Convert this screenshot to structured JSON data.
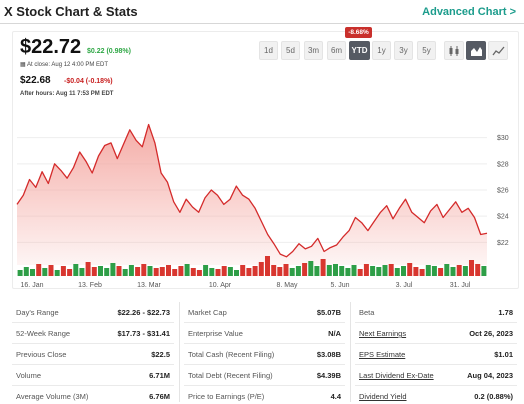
{
  "header": {
    "title": "X Stock Chart & Stats",
    "advanced_link": "Advanced Chart >"
  },
  "quote": {
    "price": "$22.72",
    "change": "$0.22 (0.98%)",
    "close_note": "At close: Aug 12 4:00 PM EDT",
    "after_hours_price": "$22.68",
    "after_hours_change": "-$0.04 (-0.18%)",
    "after_hours_note": "After hours: Aug 11 7:53 PM EDT"
  },
  "ranges": {
    "buttons": [
      "1d",
      "5d",
      "3m",
      "6m",
      "YTD",
      "1y",
      "3y",
      "5y"
    ],
    "active": "YTD",
    "active_change": "-8.68%"
  },
  "chart_types": [
    {
      "name": "candlestick-icon",
      "active": false
    },
    {
      "name": "mountain-icon",
      "active": true
    },
    {
      "name": "line-chart-icon",
      "active": false
    }
  ],
  "colors": {
    "line": "#d42b2b",
    "fill": "#f4a8a2",
    "volume_red": "#d8362f",
    "volume_green": "#2e9e47",
    "link": "#1c9c8c",
    "positive": "#2ea745",
    "negative": "#c81e1e"
  },
  "chart_data": {
    "type": "area",
    "x_ticks": [
      "16. Jan",
      "13. Feb",
      "13. Mar",
      "10. Apr",
      "8. May",
      "5. Jun",
      "3. Jul",
      "31. Jul"
    ],
    "y_ticks": [
      22,
      24,
      26,
      28,
      30
    ],
    "ylim": [
      20.5,
      31.5
    ],
    "grid": true,
    "series": [
      {
        "values": [
          24.9,
          25.6,
          26.8,
          26.2,
          27.4,
          26.5,
          28.0,
          27.5,
          26.9,
          27.7,
          28.9,
          28.2,
          27.3,
          28.6,
          29.4,
          29.6,
          28.4,
          29.5,
          30.6,
          29.8,
          29.3,
          31.0,
          29.6,
          27.3,
          26.6,
          25.1,
          24.3,
          25.3,
          24.7,
          24.3,
          25.4,
          26.0,
          25.6,
          24.9,
          25.3,
          26.3,
          25.6,
          25.3,
          24.6,
          23.6,
          22.6,
          21.9,
          21.1,
          20.9,
          21.3,
          21.9,
          21.5,
          21.7,
          22.3,
          21.3,
          21.6,
          21.8,
          22.4,
          22.9,
          23.9,
          23.5,
          22.9,
          23.6,
          24.3,
          24.8,
          23.8,
          24.6,
          25.3,
          24.3,
          23.9,
          23.5,
          24.4,
          24.9,
          23.9,
          24.5,
          25.1,
          24.3,
          24.6,
          23.9,
          22.6,
          22.7
        ]
      }
    ],
    "volume_relative": [
      0.3,
      0.45,
      0.35,
      0.6,
      0.4,
      0.55,
      0.3,
      0.5,
      0.35,
      0.6,
      0.4,
      0.7,
      0.45,
      0.5,
      0.4,
      0.65,
      0.5,
      0.35,
      0.55,
      0.45,
      0.6,
      0.5,
      0.4,
      0.45,
      0.55,
      0.35,
      0.5,
      0.6,
      0.4,
      0.3,
      0.55,
      0.4,
      0.35,
      0.5,
      0.45,
      0.3,
      0.55,
      0.4,
      0.5,
      0.7,
      1.0,
      0.55,
      0.45,
      0.6,
      0.4,
      0.5,
      0.65,
      0.75,
      0.5,
      0.85,
      0.55,
      0.6,
      0.5,
      0.4,
      0.55,
      0.35,
      0.6,
      0.5,
      0.45,
      0.55,
      0.6,
      0.4,
      0.5,
      0.65,
      0.45,
      0.35,
      0.55,
      0.5,
      0.4,
      0.6,
      0.45,
      0.55,
      0.5,
      0.8,
      0.6,
      0.5
    ]
  },
  "stats": [
    [
      {
        "label": "Day's Range",
        "value": "$22.26 - $22.73",
        "link": false
      },
      {
        "label": "52-Week Range",
        "value": "$17.73 - $31.41",
        "link": false
      },
      {
        "label": "Previous Close",
        "value": "$22.5",
        "link": false
      },
      {
        "label": "Volume",
        "value": "6.71M",
        "link": false
      },
      {
        "label": "Average Volume (3M)",
        "value": "6.76M",
        "link": false
      }
    ],
    [
      {
        "label": "Market Cap",
        "value": "$5.07B",
        "link": false
      },
      {
        "label": "Enterprise Value",
        "value": "N/A",
        "link": false
      },
      {
        "label": "Total Cash (Recent Filing)",
        "value": "$3.08B",
        "link": false
      },
      {
        "label": "Total Debt (Recent Filing)",
        "value": "$4.39B",
        "link": false
      },
      {
        "label": "Price to Earnings (P/E)",
        "value": "4.4",
        "link": false
      }
    ],
    [
      {
        "label": "Beta",
        "value": "1.78",
        "link": false
      },
      {
        "label": "Next Earnings",
        "value": "Oct 26, 2023",
        "link": true
      },
      {
        "label": "EPS Estimate",
        "value": "$1.01",
        "link": true
      },
      {
        "label": "Last Dividend Ex-Date",
        "value": "Aug 04, 2023",
        "link": true
      },
      {
        "label": "Dividend Yield",
        "value": "0.2 (0.88%)",
        "link": true
      }
    ]
  ]
}
